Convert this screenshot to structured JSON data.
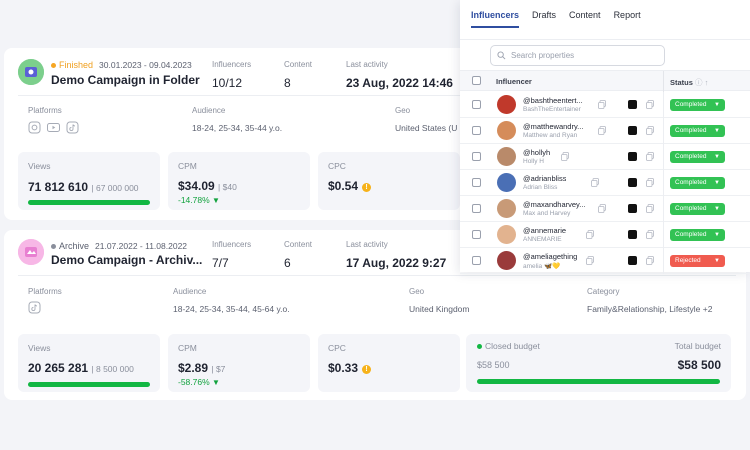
{
  "campaigns": [
    {
      "status": "Finished",
      "status_color": "#f6a623",
      "dates": "30.01.2023 - 09.04.2023",
      "title": "Demo Campaign in Folder",
      "influencers_label": "Influencers",
      "influencers": "10/12",
      "content_label": "Content",
      "content": "8",
      "last_activity_label": "Last activity",
      "last_activity": "23 Aug, 2022 14:46",
      "platforms_label": "Platforms",
      "audience_label": "Audience",
      "audience": "18-24, 25-34, 35-44 y.o.",
      "geo_label": "Geo",
      "geo": "United States (U",
      "views_label": "Views",
      "views": "71 812 610",
      "views_target": "| 67 000 000",
      "views_progress": 1.0,
      "cpm_label": "CPM",
      "cpm": "$34.09",
      "cpm_target": "| $40",
      "cpm_delta": "-14.78%",
      "cpc_label": "CPC",
      "cpc": "$0.54",
      "platforms": [
        "instagram-icon",
        "youtube-icon",
        "tiktok-icon"
      ]
    },
    {
      "status": "Archive",
      "status_color": "#8a8f9c",
      "dates": "21.07.2022 - 11.08.2022",
      "title": "Demo Campaign - Archiv...",
      "influencers_label": "Influencers",
      "influencers": "7/7",
      "content_label": "Content",
      "content": "6",
      "last_activity_label": "Last activity",
      "last_activity": "17 Aug, 2022 9:27",
      "platforms_label": "Platforms",
      "audience_label": "Audience",
      "audience": "18-24, 25-34, 35-44, 45-64 y.o.",
      "geo_label": "Geo",
      "geo": "United Kingdom",
      "category_label": "Category",
      "category": "Family&Relationship, Lifestyle +2",
      "views_label": "Views",
      "views": "20 265 281",
      "views_target": "| 8 500 000",
      "views_progress": 1.0,
      "cpm_label": "CPM",
      "cpm": "$2.89",
      "cpm_target": "| $7",
      "cpm_delta": "-58.76%",
      "cpc_label": "CPC",
      "cpc": "$0.33",
      "closed_budget_label": "Closed budget",
      "closed_budget": "$58 500",
      "total_budget_label": "Total budget",
      "total_budget": "$58 500",
      "budget_progress": 1.0,
      "platforms": [
        "tiktok-icon"
      ]
    }
  ],
  "panel": {
    "tabs": [
      "Influencers",
      "Drafts",
      "Content",
      "Report"
    ],
    "active_tab": "Influencers",
    "search_placeholder": "Search properties",
    "col_influencer": "Influencer",
    "col_status": "Status",
    "rows": [
      {
        "handle": "@bashtheentert...",
        "name": "BashTheEntertainer",
        "status": "Completed",
        "color": "#32c254"
      },
      {
        "handle": "@matthewandry...",
        "name": "Matthew and Ryan",
        "status": "Completed",
        "color": "#32c254"
      },
      {
        "handle": "@hollyh",
        "name": "Holly H",
        "status": "Completed",
        "color": "#32c254"
      },
      {
        "handle": "@adrianbliss",
        "name": "Adrian Bliss",
        "status": "Completed",
        "color": "#32c254"
      },
      {
        "handle": "@maxandharvey...",
        "name": "Max and Harvey",
        "status": "Completed",
        "color": "#32c254"
      },
      {
        "handle": "@annemarie",
        "name": "ANNEMARIE",
        "status": "Completed",
        "color": "#32c254"
      },
      {
        "handle": "@ameliagething",
        "name": "amelia 🦋💛",
        "status": "Rejected",
        "color": "#f05b4f"
      }
    ]
  }
}
